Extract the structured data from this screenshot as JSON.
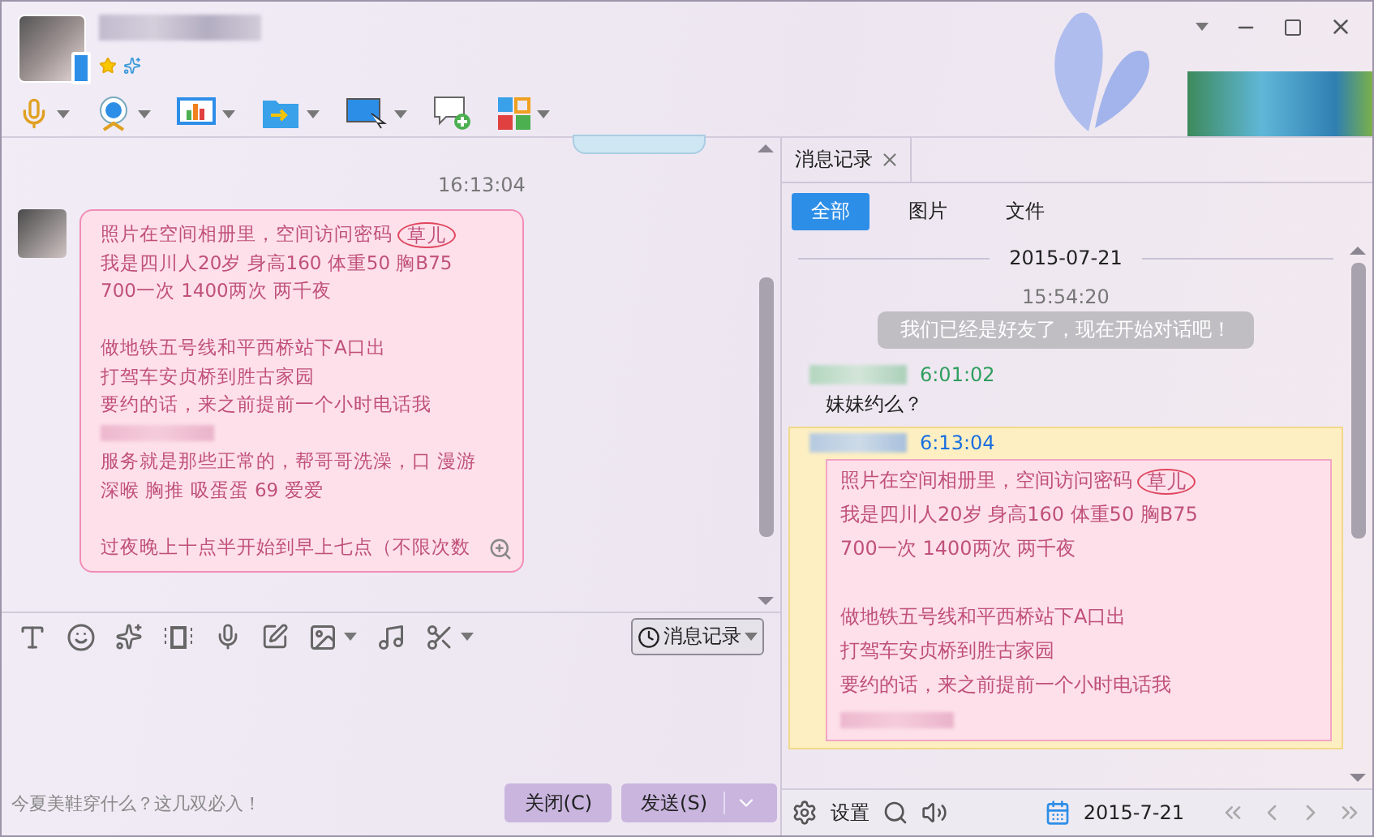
{
  "chat": {
    "time": "16:13:04",
    "message": {
      "lines": [
        {
          "kind": "text",
          "text": "照片在空间相册里，空间访问密码",
          "circled": "草儿"
        },
        {
          "kind": "text",
          "text": "我是四川人20岁 身高160 体重50 胸B75"
        },
        {
          "kind": "text",
          "text": "700一次 1400两次 两千夜"
        },
        {
          "kind": "blank"
        },
        {
          "kind": "text",
          "text": "做地铁五号线和平西桥站下A口出"
        },
        {
          "kind": "text",
          "text": "打驾车安贞桥到胜古家园"
        },
        {
          "kind": "text",
          "text": "要约的话，来之前提前一个小时电话我"
        },
        {
          "kind": "blurred"
        },
        {
          "kind": "text",
          "text": "服务就是那些正常的，帮哥哥洗澡，口 漫游"
        },
        {
          "kind": "text",
          "text": "深喉 胸推 吸蛋蛋 69 爱爱"
        },
        {
          "kind": "blank"
        },
        {
          "kind": "text",
          "text": "过夜晚上十点半开始到早上七点（不限次数"
        }
      ]
    }
  },
  "compose": {
    "history_button": "消息记录",
    "ad_text": "今夏美鞋穿什么？这几双必入！",
    "buttons": [
      {
        "label": "关闭(C)",
        "kind": "close"
      },
      {
        "label": "发送(S)",
        "kind": "send"
      }
    ]
  },
  "history": {
    "tab": "消息记录",
    "filters": [
      {
        "label": "全部",
        "selected": true
      },
      {
        "label": "图片",
        "selected": false
      },
      {
        "label": "文件",
        "selected": false
      }
    ],
    "date": "2015-07-21",
    "entries": [
      {
        "kind": "time",
        "text": "15:54:20"
      },
      {
        "kind": "notice",
        "text": "我们已经是好友了，现在开始对话吧！"
      },
      {
        "kind": "message",
        "time": "6:01:02",
        "color": "#2e9e5e",
        "highlighted": false,
        "text": "妹妹约么？"
      },
      {
        "kind": "message",
        "time": "6:13:04",
        "color": "#1a6fe0",
        "highlighted": true,
        "lines": [
          {
            "kind": "text",
            "text": "照片在空间相册里，空间访问密码",
            "circled": "草儿"
          },
          {
            "kind": "text",
            "text": "我是四川人20岁 身高160 体重50 胸B75"
          },
          {
            "kind": "text",
            "text": "700一次 1400两次 两千夜"
          },
          {
            "kind": "blank"
          },
          {
            "kind": "text",
            "text": "做地铁五号线和平西桥站下A口出"
          },
          {
            "kind": "text",
            "text": "打驾车安贞桥到胜古家园"
          },
          {
            "kind": "text",
            "text": "要约的话，来之前提前一个小时电话我"
          },
          {
            "kind": "blurred"
          }
        ]
      }
    ],
    "footer": {
      "settings": "设置",
      "date": "2015-7-21"
    }
  }
}
